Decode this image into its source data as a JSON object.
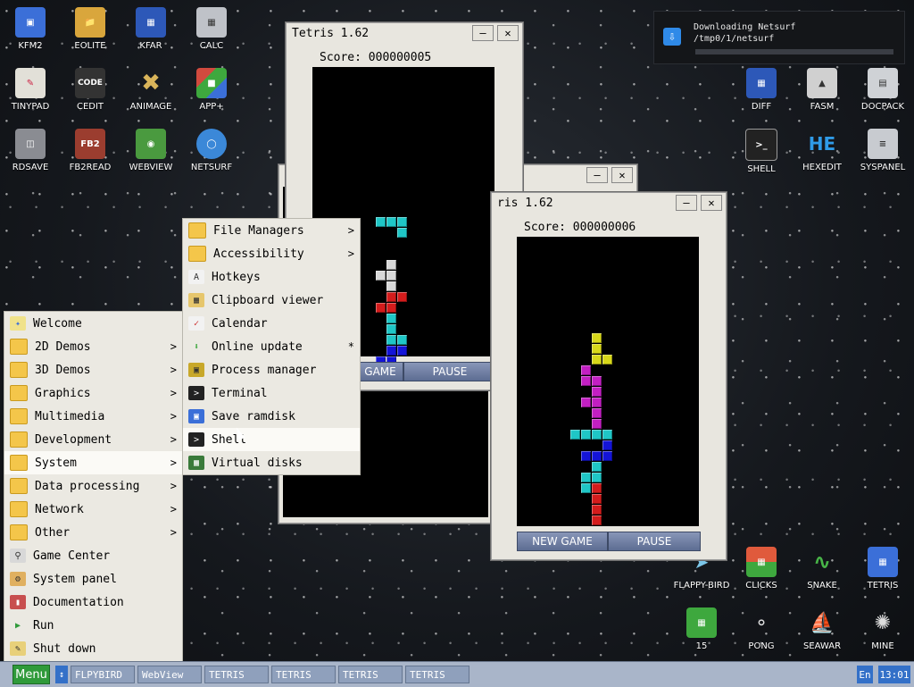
{
  "desktop_icons": [
    {
      "label": "KFM2",
      "icon": "floppy-icon",
      "color": "#3b6fd8"
    },
    {
      "label": "EOLITE",
      "icon": "folder-icon",
      "color": "#d9a63c"
    },
    {
      "label": "KFAR",
      "icon": "file-manager-icon",
      "color": "#2d58b8"
    },
    {
      "label": "CALC",
      "icon": "calculator-icon",
      "color": "#bfc2c8"
    },
    {
      "label": "TINYPAD",
      "icon": "notepad-icon",
      "color": "#e2e0d8"
    },
    {
      "label": "CEDIT",
      "icon": "code-editor-icon",
      "color": "#333333"
    },
    {
      "label": "ANIMAGE",
      "icon": "pencil-brush-icon",
      "color": "#caa75a"
    },
    {
      "label": "APP+",
      "icon": "cube-icon",
      "color": "#d14a3e"
    },
    {
      "label": "RDSAVE",
      "icon": "disk-save-icon",
      "color": "#8a8c92"
    },
    {
      "label": "FB2READ",
      "icon": "book-icon",
      "color": "#9b3d2f"
    },
    {
      "label": "WEBVIEW",
      "icon": "globe-window-icon",
      "color": "#4a9a3f"
    },
    {
      "label": "NETSURF",
      "icon": "globe-icon",
      "color": "#3b88d8"
    },
    {
      "label": "DIFF",
      "icon": "diff-icon",
      "color": "#2d58b8"
    },
    {
      "label": "FASM",
      "icon": "assembler-icon",
      "color": "#d0d0d0"
    },
    {
      "label": "DOCPACK",
      "icon": "cabinet-icon",
      "color": "#cfd2d6"
    },
    {
      "label": "SHELL",
      "icon": "terminal-icon",
      "color": "#222222"
    },
    {
      "label": "HEXEDIT",
      "icon": "hex-icon",
      "color": "#2f79d8"
    },
    {
      "label": "SYSPANEL",
      "icon": "sliders-icon",
      "color": "#c8cbd0"
    },
    {
      "label": "FLAPPY-BIRD",
      "icon": "bird-icon",
      "color": "#7bc6e8"
    },
    {
      "label": "CLICKS",
      "icon": "blocks-icon",
      "color": "#e05a3c"
    },
    {
      "label": "SNAKE",
      "icon": "snake-icon",
      "color": "#48b548"
    },
    {
      "label": "TETRIS",
      "icon": "tetris-icon",
      "color": "#3b6fd8"
    },
    {
      "label": "15",
      "icon": "puzzle15-icon",
      "color": "#3ea83e"
    },
    {
      "label": "PONG",
      "icon": "pong-icon",
      "color": "#dcdcdc"
    },
    {
      "label": "SEAWAR",
      "icon": "ship-icon",
      "color": "#8a6b4a"
    },
    {
      "label": "MINE",
      "icon": "mine-icon",
      "color": "#555555"
    }
  ],
  "notification": {
    "title": "Downloading Netsurf",
    "path": "/tmp0/1/netsurf",
    "progress": 0.0
  },
  "windows": {
    "tetris_front": {
      "title": "Tetris 1.62",
      "score_label": "Score:",
      "score": "000000005",
      "pause": "PAUSE"
    },
    "tetris_right": {
      "title": "ris 1.62",
      "score_label": "Score:",
      "score": "000000006",
      "new_game": "NEW GAME",
      "pause": "PAUSE"
    },
    "tetris_back": {
      "partial_button": "GAME"
    }
  },
  "main_menu": [
    {
      "label": "Welcome",
      "icon": "welcome-icon",
      "arrow": ""
    },
    {
      "label": "2D Demos",
      "icon": "folder-icon",
      "arrow": ">"
    },
    {
      "label": "3D Demos",
      "icon": "folder-icon",
      "arrow": ">"
    },
    {
      "label": "Graphics",
      "icon": "folder-icon",
      "arrow": ">"
    },
    {
      "label": "Multimedia",
      "icon": "folder-icon",
      "arrow": ">"
    },
    {
      "label": "Development",
      "icon": "folder-icon",
      "arrow": ">"
    },
    {
      "label": "System",
      "icon": "folder-icon",
      "arrow": ">"
    },
    {
      "label": "Data processing",
      "icon": "folder-icon",
      "arrow": ">"
    },
    {
      "label": "Network",
      "icon": "folder-icon",
      "arrow": ">"
    },
    {
      "label": "Other",
      "icon": "folder-icon",
      "arrow": ">"
    },
    {
      "label": "Game Center",
      "icon": "gamepad-icon",
      "arrow": ""
    },
    {
      "label": "System panel",
      "icon": "gears-icon",
      "arrow": ""
    },
    {
      "label": "Documentation",
      "icon": "books-icon",
      "arrow": ""
    },
    {
      "label": "Run",
      "icon": "play-icon",
      "arrow": ""
    },
    {
      "label": "Shut down",
      "icon": "shutdown-icon",
      "arrow": ""
    }
  ],
  "system_submenu": [
    {
      "label": "File Managers",
      "icon": "folder-icon",
      "arrow": ">"
    },
    {
      "label": "Accessibility",
      "icon": "folder-icon",
      "arrow": ">"
    },
    {
      "label": "Hotkeys",
      "icon": "keyboard-key-icon",
      "arrow": ""
    },
    {
      "label": "Clipboard viewer",
      "icon": "clipboard-icon",
      "arrow": ""
    },
    {
      "label": "Calendar",
      "icon": "calendar-icon",
      "arrow": ""
    },
    {
      "label": "Online update",
      "icon": "download-arrow-icon",
      "arrow": "*"
    },
    {
      "label": "Process manager",
      "icon": "chip-icon",
      "arrow": ""
    },
    {
      "label": "Terminal",
      "icon": "terminal-icon",
      "arrow": ""
    },
    {
      "label": "Save ramdisk",
      "icon": "floppy-icon",
      "arrow": ""
    },
    {
      "label": "Shell",
      "icon": "terminal-icon",
      "arrow": ""
    },
    {
      "label": "Virtual disks",
      "icon": "ram-icon",
      "arrow": ""
    }
  ],
  "taskbar": {
    "menu_label": "Menu",
    "tasks": [
      "FLPYBIRD",
      "WebView",
      "TETRIS",
      "TETRIS",
      "TETRIS",
      "TETRIS"
    ],
    "lang": "En",
    "time": "13:01"
  },
  "colors": {
    "cyan": "#1fc6c6",
    "white": "#d8d8d8",
    "red": "#d41c1c",
    "blue": "#1414d8",
    "yellow": "#d8d81a",
    "magenta": "#c21fc2"
  }
}
